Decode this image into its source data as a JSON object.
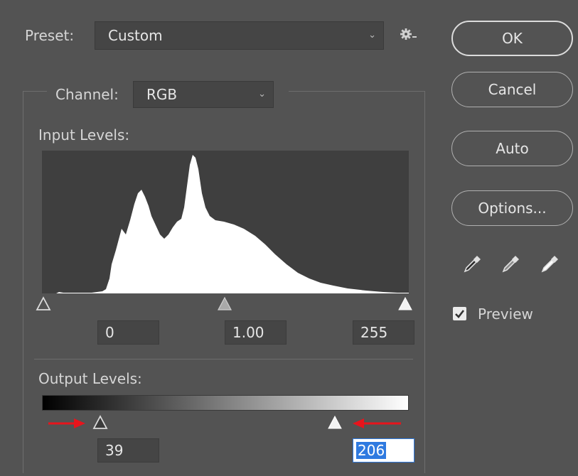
{
  "preset": {
    "label": "Preset:",
    "value": "Custom",
    "gear_icon": "gear-dropdown-icon"
  },
  "channel": {
    "label": "Channel:",
    "value": "RGB"
  },
  "input_levels": {
    "label": "Input Levels:",
    "black": "0",
    "gamma": "1.00",
    "white": "255"
  },
  "output_levels": {
    "label": "Output Levels:",
    "black": "39",
    "white": "206"
  },
  "buttons": {
    "ok": "OK",
    "cancel": "Cancel",
    "auto": "Auto",
    "options": "Options..."
  },
  "eyedroppers": [
    "black-point-eyedropper-icon",
    "gray-point-eyedropper-icon",
    "white-point-eyedropper-icon"
  ],
  "preview": {
    "label": "Preview",
    "checked": true
  },
  "colors": {
    "background": "#535353",
    "field": "#454545",
    "histogram_bg": "#3f3f3f",
    "annotation_arrow": "#e8141c",
    "selection": "#2f7ae0"
  }
}
